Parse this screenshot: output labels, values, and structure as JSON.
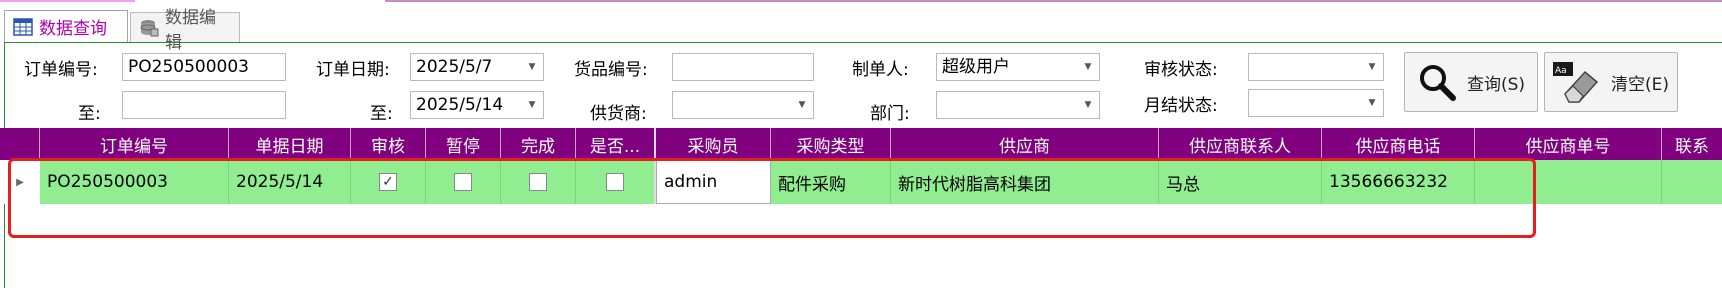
{
  "tabs": [
    {
      "label": "数据查询",
      "icon": "table-icon",
      "active": true
    },
    {
      "label": "数据编辑",
      "icon": "database-icon",
      "active": false
    }
  ],
  "filters": {
    "order_no_label": "订单编号:",
    "order_no_value": "PO250500003",
    "to_label_1": "至:",
    "to_value_1": "",
    "order_date_label": "订单日期:",
    "order_date_from": "2025/5/7",
    "to_label_2": "至:",
    "order_date_to": "2025/5/14",
    "goods_no_label": "货品编号:",
    "goods_no_value": "",
    "supplier_label": "供货商:",
    "supplier_value": "",
    "creator_label": "制单人:",
    "creator_value": "超级用户",
    "dept_label": "部门:",
    "dept_value": "",
    "audit_label": "审核状态:",
    "audit_value": "",
    "monthly_label": "月结状态:",
    "monthly_value": ""
  },
  "buttons": {
    "query_label": "查询(S)",
    "clear_label": "清空(E)"
  },
  "grid": {
    "columns": [
      "订单编号",
      "单据日期",
      "审核",
      "暂停",
      "完成",
      "是否...",
      "采购员",
      "采购类型",
      "供应商",
      "供应商联系人",
      "供应商电话",
      "供应商单号",
      "联系"
    ],
    "rows": [
      {
        "order_no": "PO250500003",
        "date": "2025/5/14",
        "audited": true,
        "paused": false,
        "completed": false,
        "flag": false,
        "buyer": "admin",
        "purchase_type": "配件采购",
        "supplier": "新时代树脂高科集团",
        "contact": "马总",
        "phone": "13566663232",
        "supplier_no": "",
        "extra": ""
      }
    ]
  },
  "colors": {
    "header_bg": "#800080",
    "row_selected_bg": "#90ee90",
    "highlight_border": "#e81e1e",
    "active_tab_text": "#b000b0"
  }
}
